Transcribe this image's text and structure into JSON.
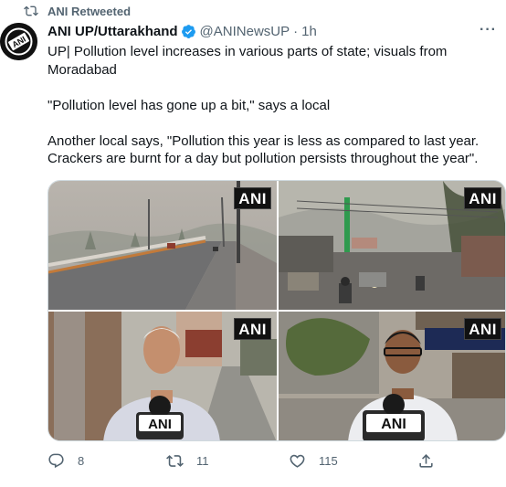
{
  "retweet": {
    "label": "ANI Retweeted",
    "icon": "retweet-icon"
  },
  "author": {
    "name": "ANI UP/Uttarakhand",
    "handle": "@ANINewsUP",
    "separator": "·",
    "time": "1h",
    "verified_color": "#1d9bf0"
  },
  "tweet": {
    "line1": "UP| Pollution level increases in various parts of state; visuals from Moradabad",
    "line2": "\"Pollution level has gone up a bit,\" says a local",
    "line3": "Another local says, \"Pollution this year is less as compared to last year. Crackers are burnt for a day but pollution persists throughout the year\"."
  },
  "media": {
    "watermark": "ANI",
    "mic_label": "ANI"
  },
  "actions": {
    "replies": "8",
    "retweets": "11",
    "likes": "115"
  },
  "colors": {
    "accent": "#1d9bf0",
    "muted": "#536471",
    "text": "#0f1419"
  }
}
